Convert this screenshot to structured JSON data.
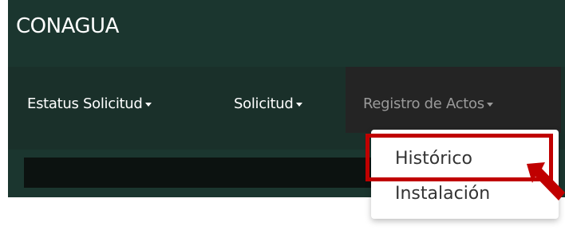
{
  "app": {
    "title": "CONAGUA"
  },
  "nav": {
    "estatus_label": "Estatus Solicitud",
    "solicitud_label": "Solicitud",
    "registro_label": "Registro de Actos"
  },
  "dropdown": {
    "items": [
      {
        "label": "Histórico"
      },
      {
        "label": "Instalación"
      }
    ]
  },
  "colors": {
    "header_bg": "#1b362f",
    "nav_bg": "#1a302a",
    "active_nav_bg": "#242424",
    "highlight": "#c00000"
  },
  "icons": {
    "menu_caret": "chevron-down-icon",
    "annotation_arrow": "arrow-pointer-icon"
  }
}
